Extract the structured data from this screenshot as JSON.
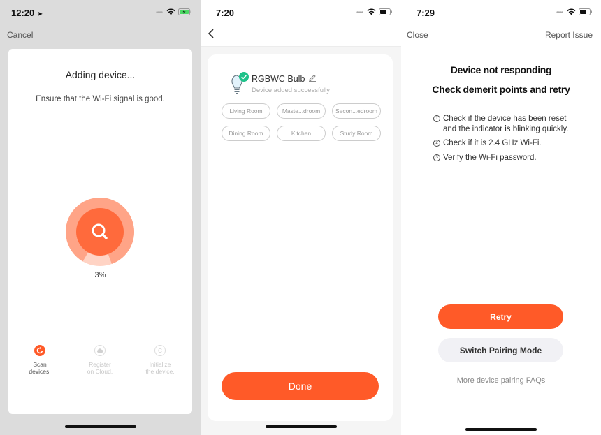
{
  "colors": {
    "accent": "#ff5a28",
    "success": "#1fc28a",
    "panel1_bg": "#dcdcdc",
    "panel2_bg": "#f5f5f5"
  },
  "screen1": {
    "status": {
      "time": "12:20",
      "location_icon": "location-arrow-icon",
      "battery": "charging"
    },
    "cancel_label": "Cancel",
    "title": "Adding device...",
    "subtitle": "Ensure that the Wi-Fi signal is good.",
    "progress_percent": 3,
    "progress_label": "3%",
    "steps": [
      {
        "line1": "Scan",
        "line2": "devices.",
        "state": "active",
        "icon": "refresh-icon"
      },
      {
        "line1": "Register",
        "line2": "on Cloud.",
        "state": "pending",
        "icon": "cloud-icon"
      },
      {
        "line1": "Initialize",
        "line2": "the device.",
        "state": "pending",
        "icon": "c-circle-icon"
      }
    ]
  },
  "screen2": {
    "status": {
      "time": "7:20",
      "battery": "normal"
    },
    "device_name": "RGBWC Bulb",
    "device_status": "Device added successfully",
    "rooms": [
      "Living Room",
      "Maste...droom",
      "Secon...edroom",
      "Dining Room",
      "Kitchen",
      "Study Room"
    ],
    "done_label": "Done"
  },
  "screen3": {
    "status": {
      "time": "7:29",
      "battery": "normal"
    },
    "close_label": "Close",
    "report_label": "Report Issue",
    "heading1": "Device not responding",
    "heading2": "Check demerit points and retry",
    "tips": [
      {
        "num": "1",
        "text": "Check if the device has been reset and the indicator is blinking quickly."
      },
      {
        "num": "2",
        "text": "Check if it is 2.4 GHz Wi-Fi."
      },
      {
        "num": "3",
        "text": "Verify the Wi-Fi password."
      }
    ],
    "retry_label": "Retry",
    "switch_label": "Switch Pairing Mode",
    "faq_label": "More device pairing FAQs"
  }
}
